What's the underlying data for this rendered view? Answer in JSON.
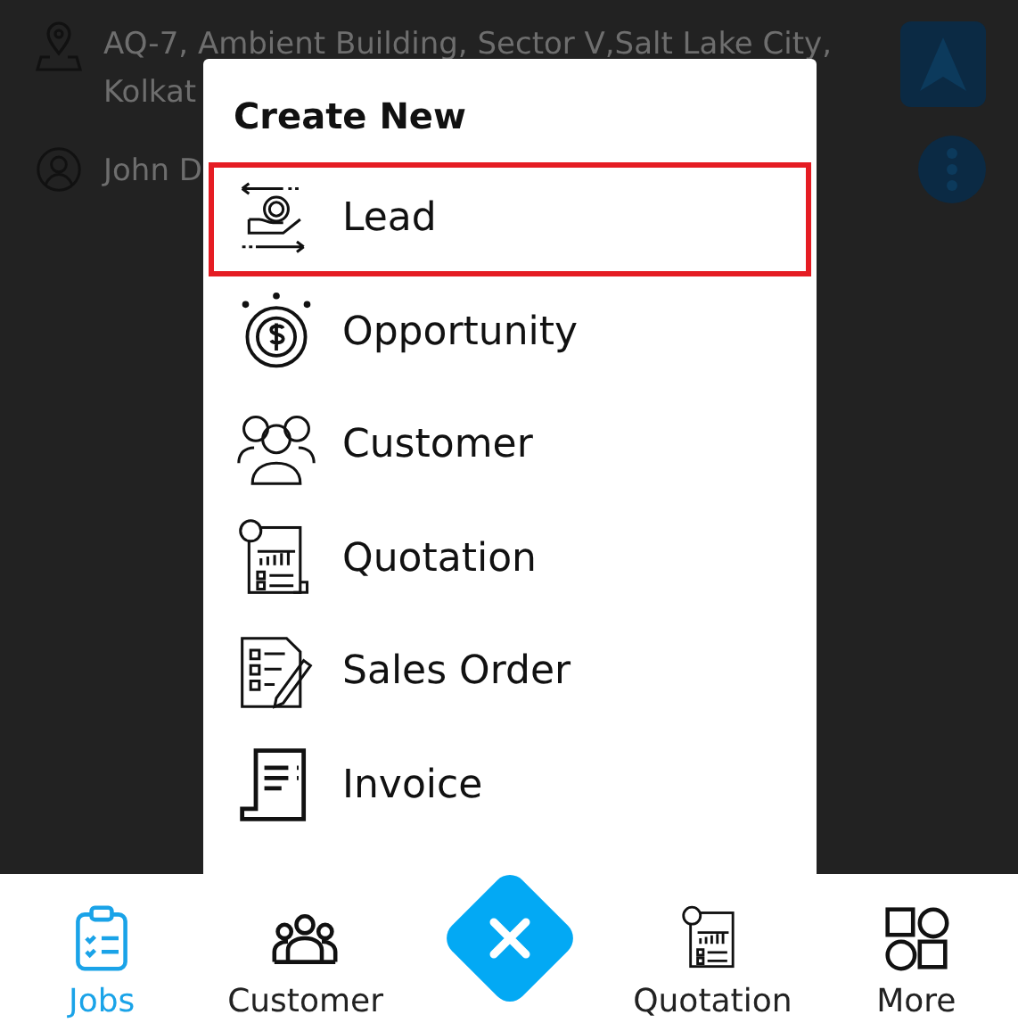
{
  "background": {
    "address_line_1": "AQ-7, Ambient Building, Sector V,Salt Lake City,",
    "address_line_2": "Kolkat",
    "contact_name": "John D"
  },
  "dialog": {
    "title": "Create New",
    "items": [
      {
        "label": "Lead",
        "kind": "lead",
        "selected": true
      },
      {
        "label": "Opportunity",
        "kind": "opportunity",
        "selected": false
      },
      {
        "label": "Customer",
        "kind": "customer",
        "selected": false
      },
      {
        "label": "Quotation",
        "kind": "quotation",
        "selected": false
      },
      {
        "label": "Sales Order",
        "kind": "sales-order",
        "selected": false
      },
      {
        "label": "Invoice",
        "kind": "invoice",
        "selected": false
      }
    ]
  },
  "bottom_nav": {
    "items": [
      {
        "label": "Jobs",
        "kind": "jobs",
        "selected": true
      },
      {
        "label": "Customer",
        "kind": "customer",
        "selected": false
      },
      {
        "kind": "close"
      },
      {
        "label": "Quotation",
        "kind": "quotation",
        "selected": false
      },
      {
        "label": "More",
        "kind": "more",
        "selected": false
      }
    ]
  }
}
